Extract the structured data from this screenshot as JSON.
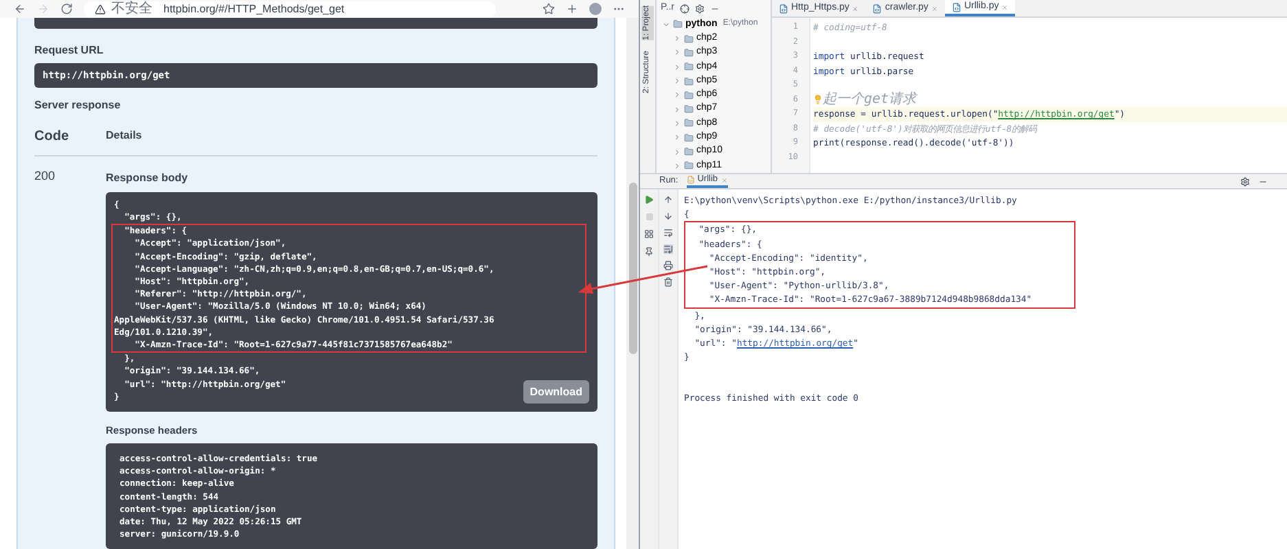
{
  "browser": {
    "security_label": "不安全",
    "address": "httpbin.org/#/HTTP_Methods/get_get"
  },
  "request_url": {
    "label": "Request URL",
    "value": "http://httpbin.org/get"
  },
  "server_response": {
    "label": "Server response",
    "columns": [
      "Code",
      "Details"
    ],
    "code": "200",
    "response_body": {
      "label": "Response body",
      "lines_before": [
        "{",
        "  \"args\": {},"
      ],
      "highlighted_lines": [
        "  \"headers\": {",
        "    \"Accept\": \"application/json\",",
        "    \"Accept-Encoding\": \"gzip, deflate\",",
        "    \"Accept-Language\": \"zh-CN,zh;q=0.9,en;q=0.8,en-GB;q=0.7,en-US;q=0.6\",",
        "    \"Host\": \"httpbin.org\",",
        "    \"Referer\": \"http://httpbin.org/\",",
        "    \"User-Agent\": \"Mozilla/5.0 (Windows NT 10.0; Win64; x64)",
        "AppleWebKit/537.36 (KHTML, like Gecko) Chrome/101.0.4951.54 Safari/537.36",
        "Edg/101.0.1210.39\",",
        "    \"X-Amzn-Trace-Id\": \"Root=1-627c9a77-445f81c7371585767ea648b2\""
      ],
      "lines_after": [
        "  },",
        "  \"origin\": \"39.144.134.66\",",
        "  \"url\": \"http://httpbin.org/get\"",
        "}"
      ],
      "download_button": "Download"
    },
    "response_headers": {
      "label": "Response headers",
      "lines": [
        "access-control-allow-credentials: true",
        "access-control-allow-origin: *",
        "connection: keep-alive",
        "content-length: 544",
        "content-type: application/json",
        "date: Thu, 12 May 2022 05:26:15 GMT",
        "server: gunicorn/19.9.0"
      ]
    }
  },
  "ide": {
    "project_label": "P..r",
    "side_tabs": [
      "1: Project",
      "2: Structure"
    ],
    "tree": {
      "name": "python",
      "path": "E:\\python",
      "expanded": true,
      "children": [
        {
          "name": "chp2",
          "expanded": false
        },
        {
          "name": "chp3",
          "expanded": false
        },
        {
          "name": "chp4",
          "expanded": false
        },
        {
          "name": "chp5",
          "expanded": false
        },
        {
          "name": "chp6",
          "expanded": false
        },
        {
          "name": "chp7",
          "expanded": false
        },
        {
          "name": "chp8",
          "expanded": false
        },
        {
          "name": "chp9",
          "expanded": false
        },
        {
          "name": "chp10",
          "expanded": false
        },
        {
          "name": "chp11",
          "expanded": false
        }
      ]
    },
    "editor_tabs": [
      {
        "label": "Http_Https.py",
        "selected": false
      },
      {
        "label": "crawler.py",
        "selected": false
      },
      {
        "label": "Urllib.py",
        "selected": true
      }
    ],
    "code_lines": [
      {
        "number": "1",
        "kind": "comment",
        "text": "# coding=utf-8"
      },
      {
        "number": "2",
        "kind": "blank"
      },
      {
        "number": "3",
        "kind": "import",
        "keyword": "import",
        "text": " urllib.request"
      },
      {
        "number": "4",
        "kind": "import",
        "keyword": "import",
        "text": " urllib.parse"
      },
      {
        "number": "5",
        "kind": "blank"
      },
      {
        "number": "6",
        "kind": "hint",
        "text": "起一个get请求"
      },
      {
        "number": "7",
        "kind": "link",
        "before": "response = urllib.request.urlopen(\"",
        "link": "http://httpbin.org/get",
        "after": "\")"
      },
      {
        "number": "8",
        "kind": "comment",
        "text": "# decode('utf-8')对获取的网页信息进行utf-8的解码"
      },
      {
        "number": "9",
        "kind": "code",
        "text": "print(response.read().decode('utf-8'))"
      },
      {
        "number": "10",
        "kind": "blank"
      }
    ],
    "run_panel": {
      "label": "Run:",
      "tab": "Urllib",
      "command": "E:\\python\\venv\\Scripts\\python.exe E:/python/instance3/Urllib.py",
      "lines_before": [
        {
          "kind": "text",
          "text": "{"
        }
      ],
      "highlighted_lines": [
        {
          "kind": "text",
          "text": "  \"args\": {},"
        },
        {
          "kind": "text",
          "text": "  \"headers\": {"
        },
        {
          "kind": "text",
          "text": "    \"Accept-Encoding\": \"identity\","
        },
        {
          "kind": "text",
          "text": "    \"Host\": \"httpbin.org\","
        },
        {
          "kind": "text",
          "text": "    \"User-Agent\": \"Python-urllib/3.8\","
        },
        {
          "kind": "text",
          "text": "    \"X-Amzn-Trace-Id\": \"Root=1-627c9a67-3889b7124d948b9868dda134\""
        }
      ],
      "lines_after": [
        {
          "kind": "text",
          "text": "  },"
        },
        {
          "kind": "text",
          "text": "  \"origin\": \"39.144.134.66\","
        },
        {
          "kind": "link",
          "before": "  \"url\": \"",
          "link": "http://httpbin.org/get",
          "after": "\""
        },
        {
          "kind": "text",
          "text": "}"
        }
      ],
      "exit_message": "Process finished with exit code 0"
    }
  }
}
